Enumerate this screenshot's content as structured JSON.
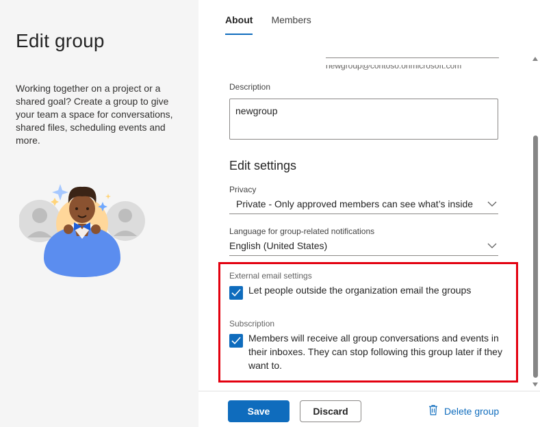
{
  "left": {
    "title": "Edit group",
    "description": "Working together on a project or a shared goal? Create a group to give your team a space for conversations, shared files, scheduling events and more."
  },
  "tabs": [
    {
      "label": "About",
      "active": true
    },
    {
      "label": "Members",
      "active": false
    }
  ],
  "form": {
    "email_hint": "newgroup@contoso.onmicrosoft.com",
    "description_label": "Description",
    "description_value": "newgroup",
    "edit_settings_title": "Edit settings",
    "privacy_label": "Privacy",
    "privacy_value": "Private - Only approved members can see what’s inside",
    "language_label": "Language for group-related notifications",
    "language_value": "English (United States)",
    "external_email_label": "External email settings",
    "external_email_text": "Let people outside the organization email the groups",
    "external_email_checked": true,
    "subscription_label": "Subscription",
    "subscription_text": "Members will receive all group conversations and events in their inboxes. They can stop following this group later if they want to.",
    "subscription_checked": true
  },
  "footer": {
    "save_label": "Save",
    "discard_label": "Discard",
    "delete_label": "Delete group"
  },
  "colors": {
    "accent": "#0f6cbd",
    "highlight": "#e3000f",
    "left_pane_bg": "#f5f5f5"
  },
  "icons": {
    "chevron": "chevron-down-icon",
    "checkmark": "checkmark-icon",
    "trash": "trash-icon"
  }
}
